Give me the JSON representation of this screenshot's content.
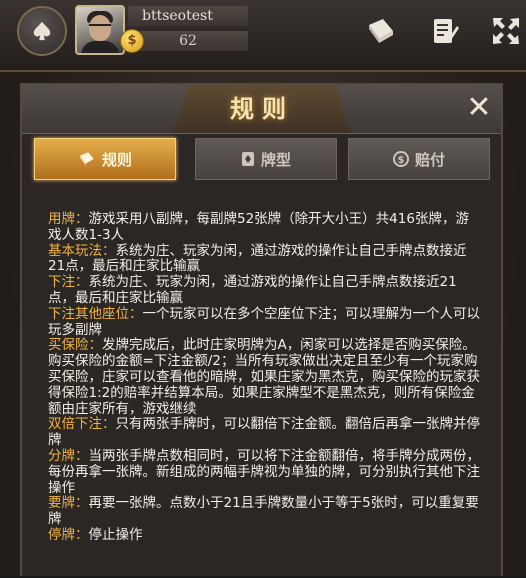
{
  "header": {
    "username": "bttseotest",
    "coins": "62",
    "coin_symbol": "$"
  },
  "dialog": {
    "title": "规则",
    "close_symbol": "✕",
    "tabs": [
      {
        "label": "规则",
        "icon": "book-icon",
        "active": true
      },
      {
        "label": "牌型",
        "icon": "card-icon",
        "active": false
      },
      {
        "label": "赔付",
        "icon": "payout-icon",
        "active": false
      }
    ],
    "rules": [
      {
        "label": "用牌：",
        "text": "游戏采用八副牌，每副牌52张牌（除开大小王）共416张牌，游戏人数1-3人"
      },
      {
        "label": "基本玩法：",
        "text": "系统为庄、玩家为闲，通过游戏的操作让自己手牌点数接近21点，最后和庄家比输赢"
      },
      {
        "label": "下注：",
        "text": "系统为庄、玩家为闲，通过游戏的操作让自己手牌点数接近21点，最后和庄家比输赢"
      },
      {
        "label": "下注其他座位：",
        "text": "一个玩家可以在多个空座位下注；可以理解为一个人可以玩多副牌"
      },
      {
        "label": "买保险：",
        "text": "发牌完成后，此时庄家明牌为A，闲家可以选择是否购买保险。购买保险的金额=下注金额/2；当所有玩家做出决定且至少有一个玩家购买保险，庄家可以查看他的暗牌，如果庄家为黑杰克，购买保险的玩家获得保险1:2的赔率并结算本局。如果庄家牌型不是黑杰克，则所有保险金额由庄家所有，游戏继续"
      },
      {
        "label": "双倍下注：",
        "text": "只有两张手牌时，可以翻倍下注金额。翻倍后再拿一张牌并停牌"
      },
      {
        "label": "分牌：",
        "text": "当两张手牌点数相同时，可以将下注金额翻倍，将手牌分成两份，每份再拿一张牌。新组成的两幅手牌视为单独的牌，可分别执行其他下注操作"
      },
      {
        "label": "要牌：",
        "text": "再要一张牌。点数小于21且手牌数量小于等于5张时，可以重复要牌"
      },
      {
        "label": "停牌：",
        "text": "停止操作"
      }
    ]
  },
  "colors": {
    "accent_gold": "#f1b33c",
    "tab_active": "#d28f30",
    "panel_bg": "#2b2724"
  }
}
